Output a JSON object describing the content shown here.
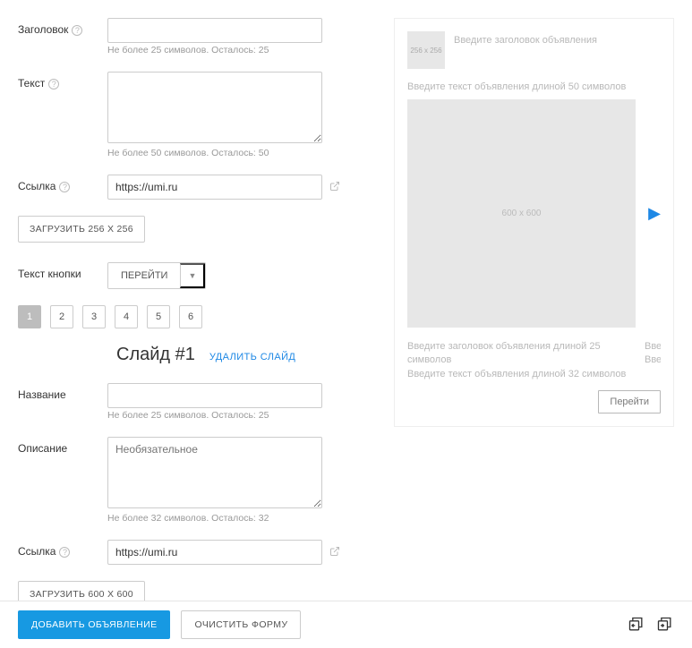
{
  "form": {
    "title_label": "Заголовок",
    "title_hint": "Не более 25 символов. Осталось: 25",
    "text_label": "Текст",
    "text_hint": "Не более 50 символов. Осталось: 50",
    "link_label": "Ссылка",
    "link_value": "https://umi.ru",
    "upload_256_label": "ЗАГРУЗИТЬ 256 X 256",
    "button_text_label": "Текст кнопки",
    "button_text_value": "ПЕРЕЙТИ"
  },
  "tabs": [
    "1",
    "2",
    "3",
    "4",
    "5",
    "6"
  ],
  "active_tab": 0,
  "slide": {
    "heading": "Слайд #1",
    "delete_label": "УДАЛИТЬ СЛАЙД",
    "name_label": "Название",
    "name_hint": "Не более 25 символов. Осталось: 25",
    "desc_label": "Описание",
    "desc_placeholder": "Необязательное",
    "desc_hint": "Не более 32 символов. Осталось: 32",
    "link_label": "Ссылка",
    "link_value": "https://umi.ru",
    "upload_600_label": "ЗАГРУЗИТЬ 600 X 600"
  },
  "preview": {
    "thumb_256_label": "256 x 256",
    "title_placeholder": "Введите заголовок объявления",
    "text_placeholder": "Введите текст объявления длиной 50 символов",
    "slide_size_label": "600 x 600",
    "caption_title": "Введите заголовок объявления длиной 25 символов",
    "caption_text": "Введите текст объявления длиной 32 символов",
    "partial_word": "Введ",
    "go_button": "Перейти"
  },
  "footer": {
    "add_button": "ДОБАВИТЬ ОБЪЯВЛЕНИЕ",
    "clear_button": "ОЧИСТИТЬ ФОРМУ"
  }
}
